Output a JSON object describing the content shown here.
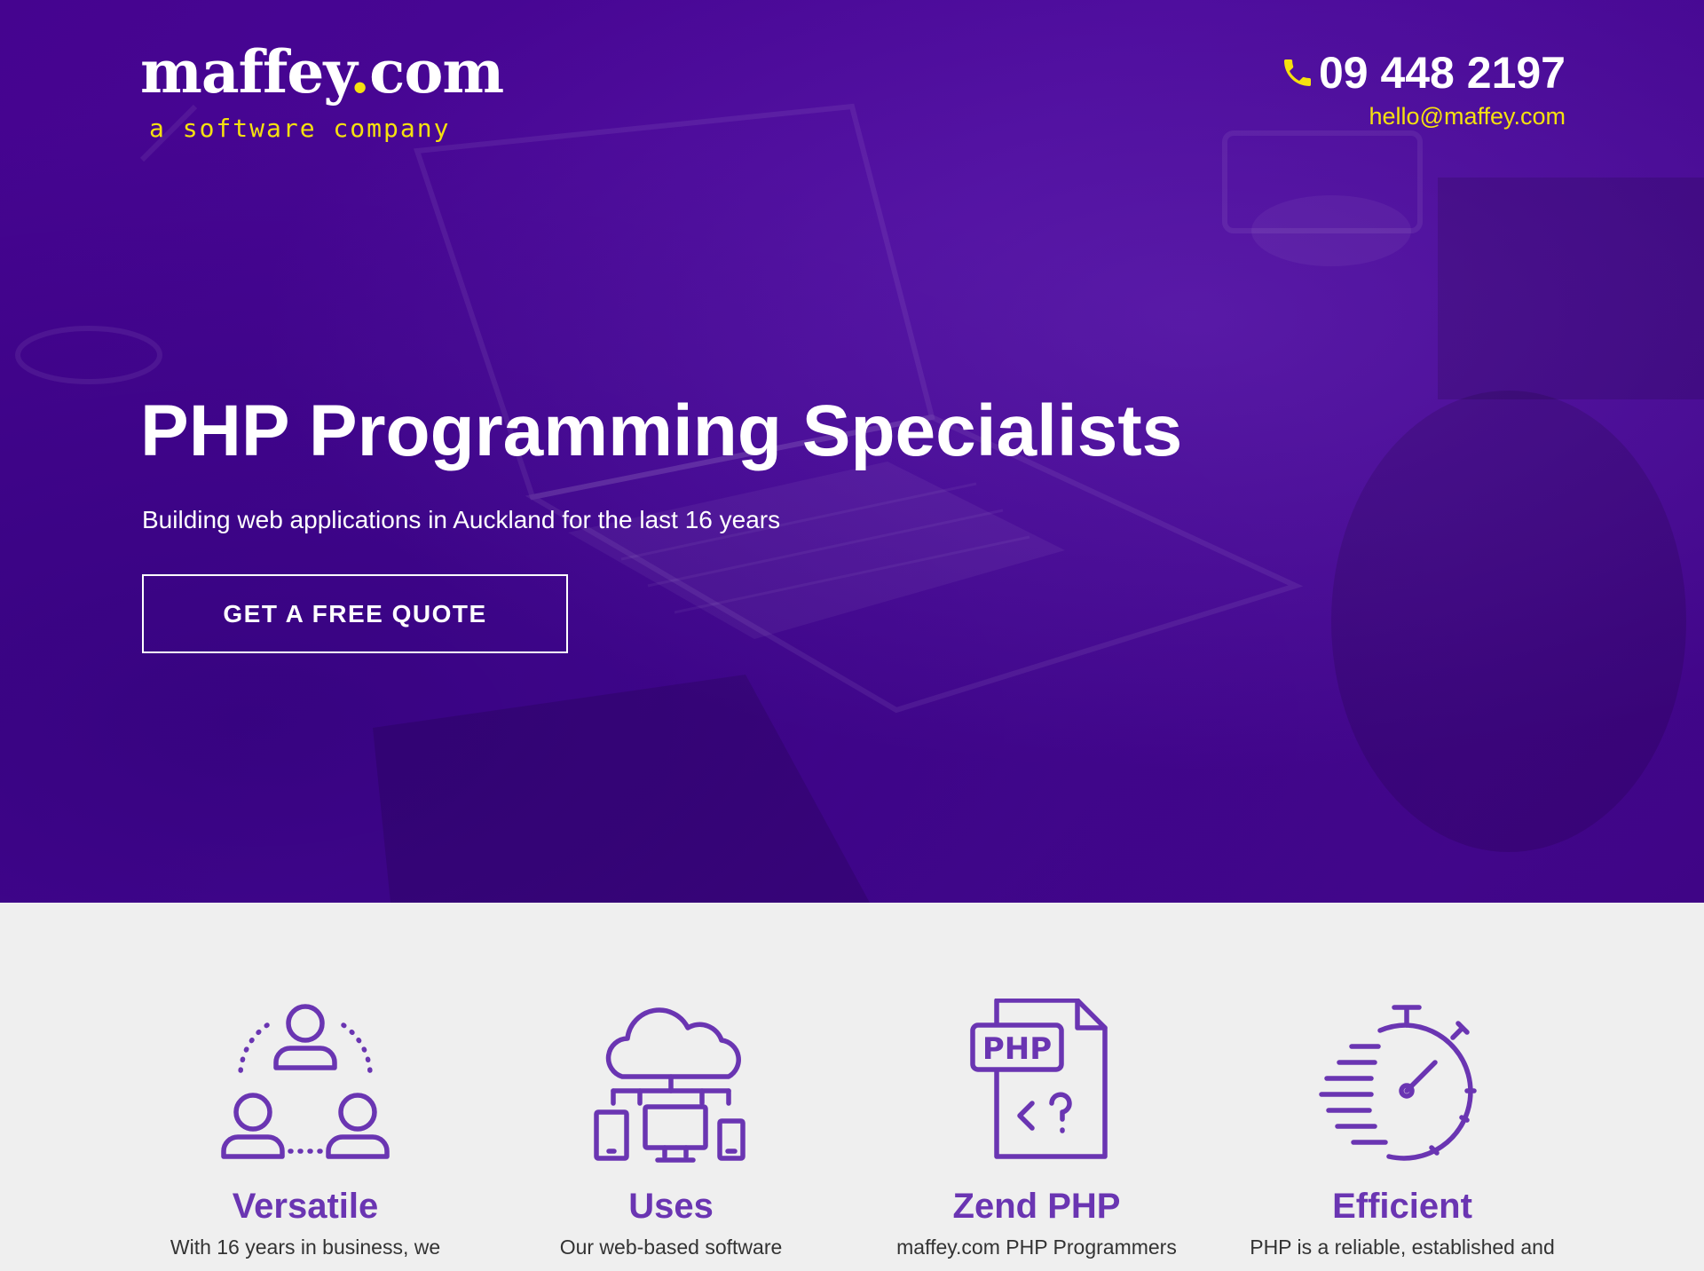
{
  "brand": {
    "name_main": "maffey",
    "name_dot": ".",
    "name_tld": "com",
    "tagline": "a software company"
  },
  "contact": {
    "phone_icon": "phone-icon",
    "phone": "09 448 2197",
    "email": "hello@maffey.com"
  },
  "hero": {
    "headline": "PHP Programming Specialists",
    "subline": "Building web applications in Auckland for the last 16 years",
    "cta_label": "GET A FREE QUOTE"
  },
  "features": [
    {
      "icon": "people-network-icon",
      "title": "Versatile",
      "text": "With 16 years in business, we"
    },
    {
      "icon": "cloud-devices-icon",
      "title": "Uses",
      "text": "Our web-based software"
    },
    {
      "icon": "php-file-icon",
      "title": "Zend PHP",
      "text": "maffey.com PHP Programmers"
    },
    {
      "icon": "stopwatch-icon",
      "title": "Efficient",
      "text": "PHP is a reliable, established and"
    }
  ],
  "colors": {
    "hero_purple": "#45048f",
    "accent_yellow": "#f5e10f",
    "feature_purple": "#6a35b2",
    "section_bg": "#efefef"
  }
}
